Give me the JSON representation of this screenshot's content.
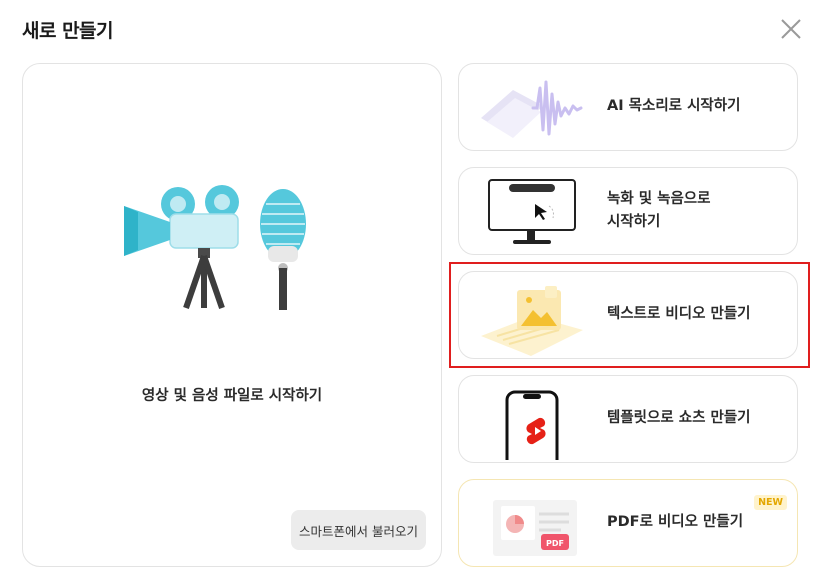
{
  "dialog": {
    "title": "새로 만들기",
    "close_icon": "close-icon"
  },
  "main_card": {
    "label": "영상 및 음성 파일로 시작하기",
    "phone_button": "스마트폰에서 불러오기"
  },
  "options": [
    {
      "label": "AI 목소리로 시작하기"
    },
    {
      "label_line1": "녹화 및 녹음으로",
      "label_line2": "시작하기"
    },
    {
      "label": "텍스트로 비디오 만들기"
    },
    {
      "label": "템플릿으로 쇼츠 만들기"
    },
    {
      "label": "PDF로 비디오 만들기",
      "badge": "NEW",
      "file_tag": "PDF"
    }
  ],
  "colors": {
    "accent_cyan": "#55c8dc",
    "highlight_red": "#e01e1e",
    "voice_purple": "#c9bff0",
    "new_badge": "#e3a700"
  }
}
